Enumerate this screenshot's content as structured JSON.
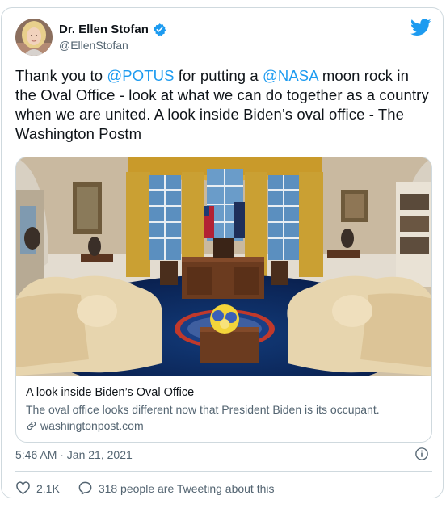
{
  "author": {
    "display_name": "Dr. Ellen Stofan",
    "handle": "@EllenStofan"
  },
  "tweet": {
    "segments": [
      {
        "text": "Thank you to ",
        "type": "text"
      },
      {
        "text": "@POTUS",
        "type": "mention"
      },
      {
        "text": " for putting a ",
        "type": "text"
      },
      {
        "text": "@NASA",
        "type": "mention"
      },
      {
        "text": " moon rock in the Oval Office - look at what we can do together as a country when we are united. A look inside Biden’s oval office - The Washington Postm",
        "type": "text"
      }
    ]
  },
  "link_card": {
    "title": "A look inside Biden’s Oval Office",
    "description": "The oval office looks different now that President Biden is its occupant.",
    "domain": "washingtonpost.com"
  },
  "meta": {
    "timestamp": "5:46 AM · Jan 21, 2021"
  },
  "actions": {
    "like_count": "2.1K",
    "conversation_label": "318 people are Tweeting about this"
  },
  "colors": {
    "accent": "#1d9bf0",
    "like_icon": "#536471",
    "secondary_text": "#536471",
    "border": "#cfd9de"
  },
  "icons": {
    "brand": "twitter-bird-icon",
    "verified": "verified-badge-icon",
    "link": "link-icon",
    "info": "info-icon",
    "like": "heart-icon",
    "conversation": "speech-bubble-icon"
  }
}
